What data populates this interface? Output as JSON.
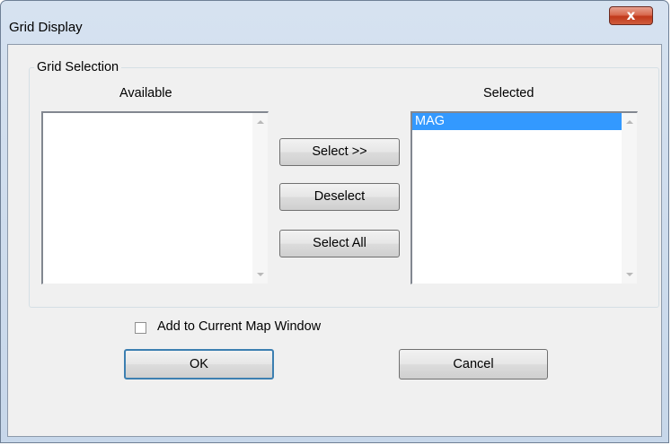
{
  "window": {
    "title": "Grid Display",
    "close_glyph": "x"
  },
  "group": {
    "title": "Grid Selection"
  },
  "available": {
    "label": "Available",
    "items": []
  },
  "selected": {
    "label": "Selected",
    "items": [
      "MAG"
    ]
  },
  "buttons": {
    "select": "Select >>",
    "deselect": "Deselect",
    "select_all": "Select All",
    "ok": "OK",
    "cancel": "Cancel"
  },
  "options": {
    "add_to_map_label": "Add to Current Map Window",
    "add_to_map_checked": false
  },
  "colors": {
    "selection": "#3399ff",
    "frame": "#d6e2f0",
    "close": "#c1381b"
  }
}
